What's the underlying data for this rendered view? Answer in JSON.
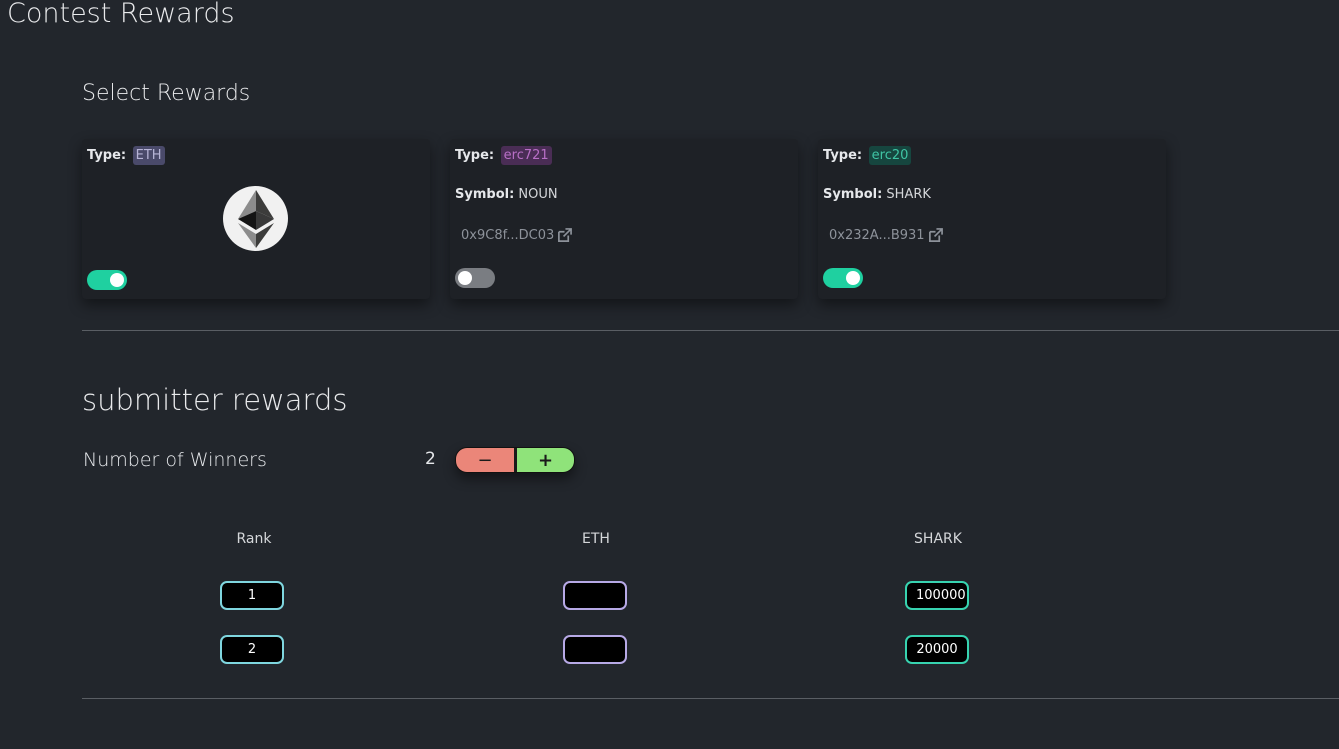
{
  "page": {
    "title": "Contest Rewards"
  },
  "select_rewards": {
    "title": "Select Rewards",
    "type_label": "Type:",
    "symbol_label": "Symbol:",
    "cards": [
      {
        "type": "ETH",
        "toggle_on": true,
        "icon": "ethereum-logo-icon"
      },
      {
        "type": "erc721",
        "symbol": "NOUN",
        "address": "0x9C8f...DC03",
        "toggle_on": false
      },
      {
        "type": "erc20",
        "symbol": "SHARK",
        "address": "0x232A...B931",
        "toggle_on": true
      }
    ]
  },
  "submitter": {
    "title": "submitter rewards",
    "winners_label": "Number of Winners",
    "winners_count": "2",
    "minus_label": "−",
    "plus_label": "+",
    "columns": [
      "Rank",
      "ETH",
      "SHARK"
    ],
    "rows": [
      {
        "rank": "1",
        "eth": "",
        "shark": "100000"
      },
      {
        "rank": "2",
        "eth": "",
        "shark": "20000"
      }
    ]
  },
  "colors": {
    "background": "#22262c",
    "toggle_on": "#1fd0a0",
    "minus": "#eb8679",
    "plus": "#8fe37a"
  }
}
